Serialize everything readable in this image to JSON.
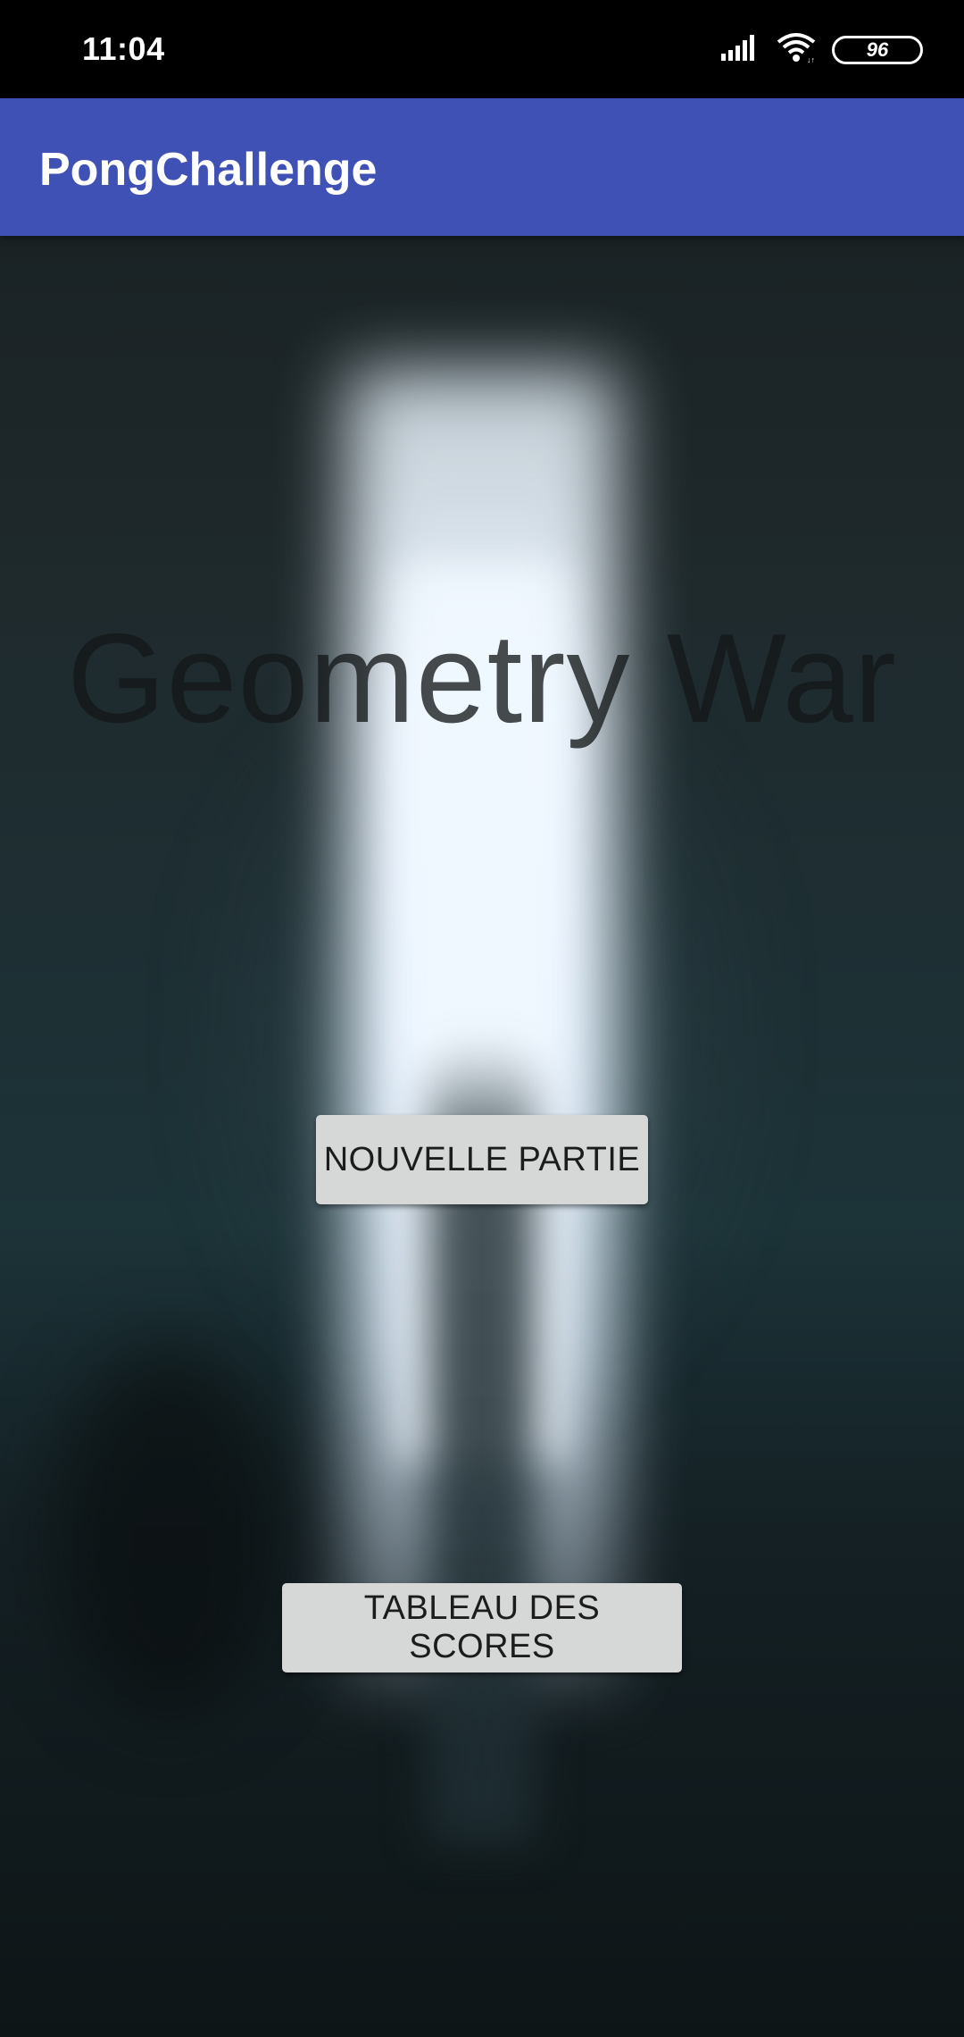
{
  "status_bar": {
    "time": "11:04",
    "battery": "96",
    "icons": [
      "signal-icon",
      "wifi-icon",
      "battery-icon"
    ]
  },
  "app_bar": {
    "title": "PongChallenge",
    "color": "#3f51b5"
  },
  "main": {
    "game_title": "Geometry War",
    "new_game_button": "NOUVELLE PARTIE",
    "scores_button": "TABLEAU DES SCORES"
  }
}
